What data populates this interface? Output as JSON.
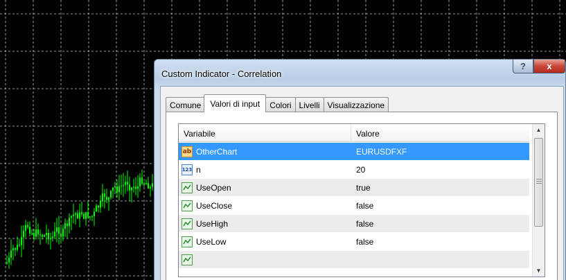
{
  "dialog": {
    "title": "Custom Indicator - Correlation",
    "help_label": "?",
    "close_label": "x"
  },
  "tabs": [
    {
      "label": "Comune",
      "active": false
    },
    {
      "label": "Valori di input",
      "active": true
    },
    {
      "label": "Colori",
      "active": false
    },
    {
      "label": "Livelli",
      "active": false
    },
    {
      "label": "Visualizzazione",
      "active": false
    }
  ],
  "grid": {
    "header": {
      "variable": "Variabile",
      "value": "Valore"
    },
    "rows": [
      {
        "icon": "string-icon",
        "icon_text": "ab",
        "name": "OtherChart",
        "value": "EURUSDFXF",
        "selected": true
      },
      {
        "icon": "integer-icon",
        "icon_text": "123",
        "name": "n",
        "value": "20"
      },
      {
        "icon": "bool-icon",
        "name": "UseOpen",
        "value": "true"
      },
      {
        "icon": "bool-icon",
        "name": "UseClose",
        "value": "false"
      },
      {
        "icon": "bool-icon",
        "name": "UseHigh",
        "value": "false"
      },
      {
        "icon": "bool-icon",
        "name": "UseLow",
        "value": "false"
      },
      {
        "icon": "bool-icon",
        "name": "",
        "value": ""
      }
    ]
  },
  "colors": {
    "chart_bg": "#000000",
    "candles": "#00ff00",
    "grid_lines": "#c8c8c8",
    "selection": "#3399ff"
  }
}
